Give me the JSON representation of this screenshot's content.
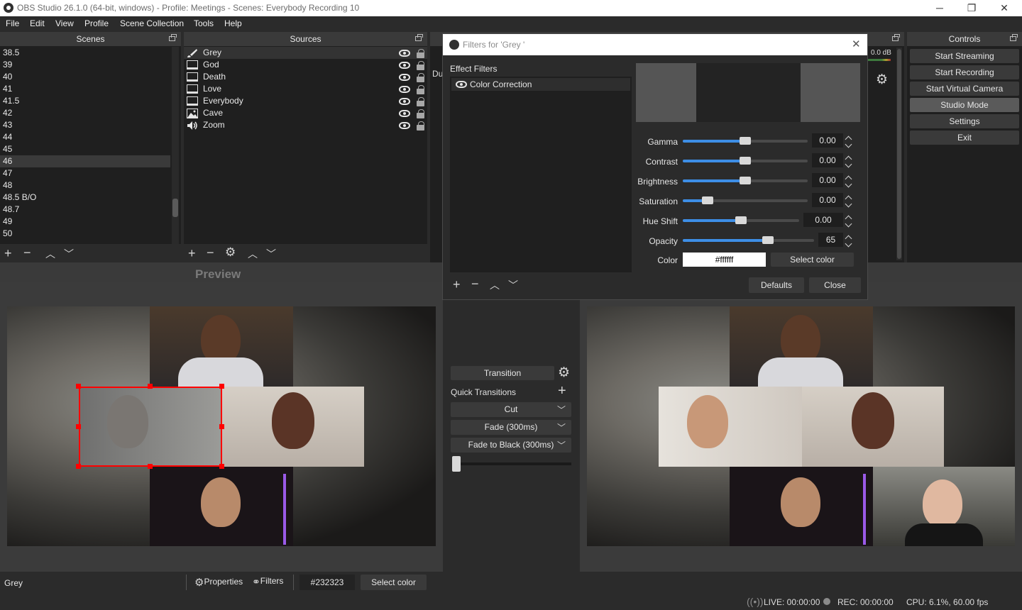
{
  "window": {
    "title": "OBS Studio 26.1.0 (64-bit, windows) - Profile: Meetings - Scenes: Everybody Recording  10",
    "minimize": "─",
    "restore": "❐",
    "close": "✕"
  },
  "menu": [
    "File",
    "Edit",
    "View",
    "Profile",
    "Scene Collection",
    "Tools",
    "Help"
  ],
  "scenes": {
    "title": "Scenes",
    "items": [
      "38.5",
      "39",
      "40",
      "41",
      "41.5",
      "42",
      "43",
      "44",
      "45",
      "46",
      "47",
      "48",
      "48.5 B/O",
      "48.7",
      "49",
      "50"
    ],
    "selected": "46"
  },
  "sources": {
    "title": "Sources",
    "items": [
      {
        "label": "Grey",
        "icon": "brush-icon"
      },
      {
        "label": "God",
        "icon": "monitor-icon"
      },
      {
        "label": "Death",
        "icon": "monitor-icon"
      },
      {
        "label": "Love",
        "icon": "monitor-icon"
      },
      {
        "label": "Everybody",
        "icon": "monitor-icon"
      },
      {
        "label": "Cave",
        "icon": "image-icon"
      },
      {
        "label": "Zoom",
        "icon": "speaker-icon"
      }
    ]
  },
  "mixer": {
    "db": "0.0 dB",
    "label_fragment": "Du"
  },
  "controls": {
    "title": "Controls",
    "buttons": [
      "Start Streaming",
      "Start Recording",
      "Start Virtual Camera",
      "Studio Mode",
      "Settings",
      "Exit"
    ]
  },
  "preview_label": "Preview",
  "filters_dialog": {
    "title": "Filters for 'Grey '",
    "effect_filters_label": "Effect Filters",
    "filter_item": "Color Correction",
    "properties": [
      {
        "label": "Gamma",
        "value": "0.00",
        "level": 0.5
      },
      {
        "label": "Contrast",
        "value": "0.00",
        "level": 0.5
      },
      {
        "label": "Brightness",
        "value": "0.00",
        "level": 0.5
      },
      {
        "label": "Saturation",
        "value": "0.00",
        "level": 0.2
      },
      {
        "label": "Hue Shift",
        "value": "0.00",
        "level": 0.5
      },
      {
        "label": "Opacity",
        "value": "65",
        "level": 0.65
      }
    ],
    "color_label": "Color",
    "color_value": "#ffffff",
    "select_color": "Select color",
    "defaults": "Defaults",
    "close": "Close"
  },
  "transitions": {
    "transition_button": "Transition",
    "quick_transitions": "Quick Transitions",
    "items": [
      "Cut",
      "Fade (300ms)",
      "Fade to Black (300ms)"
    ]
  },
  "bottom_bar": {
    "source_name": "Grey",
    "properties": "Properties",
    "filters": "Filters",
    "color_value": "#232323",
    "select_color": "Select color"
  },
  "status": {
    "live": "LIVE: 00:00:00",
    "rec": "REC: 00:00:00",
    "cpu": "CPU: 6.1%, 60.00 fps"
  },
  "colors": {
    "accent": "#3d8ee6",
    "selection_border": "#ff0000",
    "bg": "#2b2b2b",
    "dock_bg": "#1f1f1f"
  }
}
